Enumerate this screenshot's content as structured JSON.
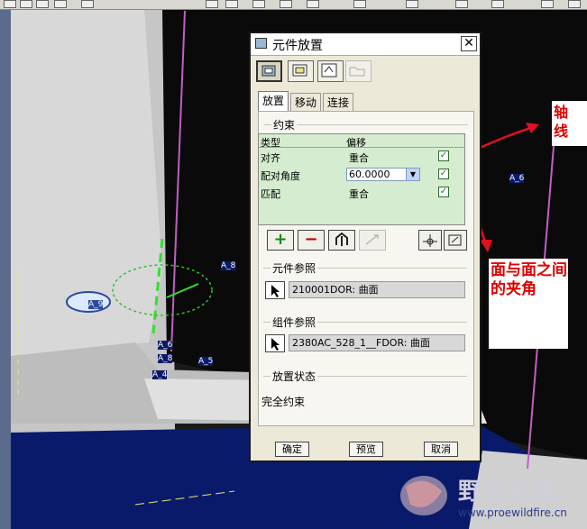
{
  "dialog": {
    "title": "元件放置",
    "close_label": "✕",
    "tabs": [
      "放置",
      "移动",
      "连接"
    ],
    "constraint_group": "约束",
    "table_headers": {
      "type": "类型",
      "offset": "偏移"
    },
    "rows": [
      {
        "type": "对齐",
        "offset": "重合",
        "checked": "✓"
      },
      {
        "type": "配对角度",
        "offset": "60.0000",
        "checked": "✓"
      },
      {
        "type": "匹配",
        "offset": "重合",
        "checked": "✓"
      }
    ],
    "add_icon": "+",
    "remove_icon": "−",
    "component_ref_group": "元件参照",
    "component_ref_value": "210001DOR: 曲面",
    "assembly_ref_group": "组件参照",
    "assembly_ref_value": "2380AC_528_1__FDOR: 曲面",
    "status_group": "放置状态",
    "status_value": "完全约束",
    "ok_label": "确定",
    "preview_label": "预览",
    "cancel_label": "取消"
  },
  "annotations": {
    "axis_note": "轴线",
    "angle_note": "面与面之间的夹角"
  },
  "axis_labels": [
    "A_6",
    "A_8",
    "A_9",
    "A_6",
    "A_8",
    "A_5",
    "A_4"
  ],
  "watermark": {
    "name": "野火论坛",
    "url": "www.proewildfire.cn"
  },
  "colors": {
    "dialog_bg": "#ece9d8",
    "table_bg": "#d5ecd0",
    "arrow": "#e01020",
    "datum_axis": "#c060c0"
  }
}
